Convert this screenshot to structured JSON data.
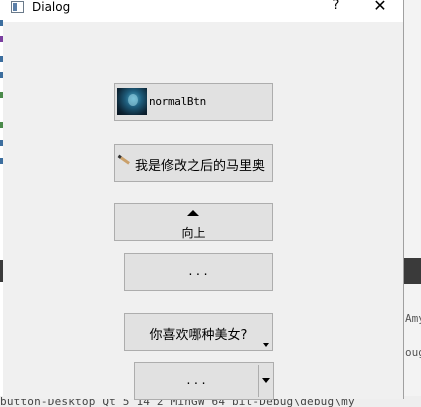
{
  "window": {
    "title": "Dialog",
    "help_glyph": "?",
    "close_glyph": "✕"
  },
  "buttons": {
    "normal": {
      "label": "normalBtn",
      "icon": "thumbnail-image-icon"
    },
    "mario": {
      "label": "我是修改之后的马里奥",
      "icon": "pencil-icon"
    },
    "up": {
      "label": "向上",
      "icon": "up-arrow-icon"
    },
    "dots1": {
      "label": "..."
    },
    "menu": {
      "label": "你喜欢哪种美女?",
      "icon": "menu-indicator-icon"
    },
    "split": {
      "label": "...",
      "icon": "dropdown-arrow-icon"
    }
  },
  "background": {
    "right_fragments": [
      "Amy",
      "oug"
    ],
    "bottom_text": "button-Desktop_Qt_5_14_2_MinGW_64_bit-Debug\\debug\\my"
  },
  "colors": {
    "dialog_bg": "#f0f0f0",
    "button_bg": "#e1e1e1",
    "button_border": "#adadad"
  }
}
